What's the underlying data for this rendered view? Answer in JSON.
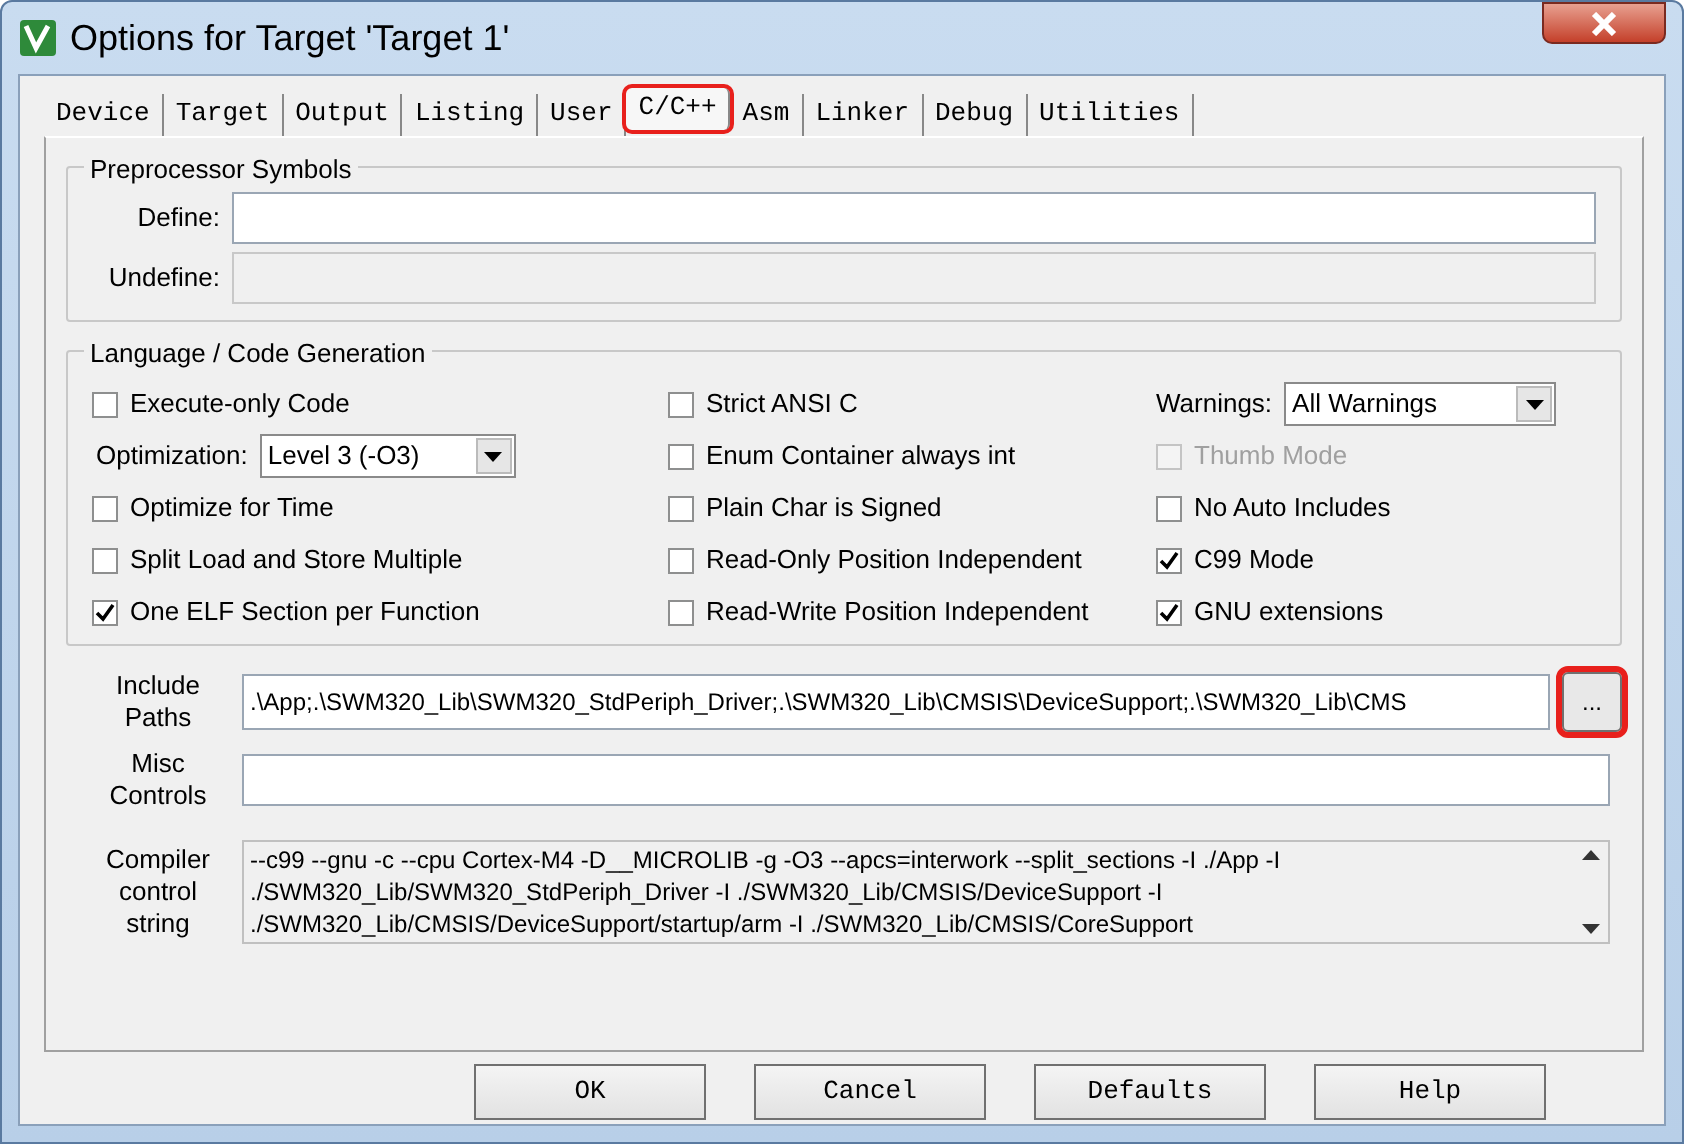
{
  "window": {
    "title": "Options for Target 'Target 1'"
  },
  "tabs": [
    {
      "label": "Device",
      "selected": false,
      "highlighted": false
    },
    {
      "label": "Target",
      "selected": false,
      "highlighted": false
    },
    {
      "label": "Output",
      "selected": false,
      "highlighted": false
    },
    {
      "label": "Listing",
      "selected": false,
      "highlighted": false
    },
    {
      "label": "User",
      "selected": false,
      "highlighted": false
    },
    {
      "label": "C/C++",
      "selected": true,
      "highlighted": true
    },
    {
      "label": "Asm",
      "selected": false,
      "highlighted": false
    },
    {
      "label": "Linker",
      "selected": false,
      "highlighted": false
    },
    {
      "label": "Debug",
      "selected": false,
      "highlighted": false
    },
    {
      "label": "Utilities",
      "selected": false,
      "highlighted": false
    }
  ],
  "preprocessor": {
    "title": "Preprocessor Symbols",
    "fields": [
      {
        "label": "Define:",
        "disabled": false
      },
      {
        "label": "Undefine:",
        "disabled": true
      }
    ]
  },
  "language": {
    "title": "Language / Code Generation",
    "columns": [
      [
        {
          "kind": "checkbox",
          "label": "Execute-only Code",
          "checked": false,
          "disabled": false
        },
        {
          "kind": "select",
          "label": "Optimization:",
          "value": "Level 3 (-O3)"
        },
        {
          "kind": "checkbox",
          "label": "Optimize for Time",
          "checked": false,
          "disabled": false
        },
        {
          "kind": "checkbox",
          "label": "Split Load and Store Multiple",
          "checked": false,
          "disabled": false
        },
        {
          "kind": "checkbox",
          "label": "One ELF Section per Function",
          "checked": true,
          "disabled": false
        }
      ],
      [
        {
          "kind": "checkbox",
          "label": "Strict ANSI C",
          "checked": false,
          "disabled": false
        },
        {
          "kind": "checkbox",
          "label": "Enum Container always int",
          "checked": false,
          "disabled": false
        },
        {
          "kind": "checkbox",
          "label": "Plain Char is Signed",
          "checked": false,
          "disabled": false
        },
        {
          "kind": "checkbox",
          "label": "Read-Only Position Independent",
          "checked": false,
          "disabled": false
        },
        {
          "kind": "checkbox",
          "label": "Read-Write Position Independent",
          "checked": false,
          "disabled": false
        }
      ],
      [
        {
          "kind": "select",
          "label": "Warnings:",
          "value": "All Warnings"
        },
        {
          "kind": "checkbox",
          "label": "Thumb Mode",
          "checked": false,
          "disabled": true
        },
        {
          "kind": "checkbox",
          "label": "No Auto Includes",
          "checked": false,
          "disabled": false
        },
        {
          "kind": "checkbox",
          "label": "C99 Mode",
          "checked": true,
          "disabled": false
        },
        {
          "kind": "checkbox",
          "label": "GNU extensions",
          "checked": true,
          "disabled": false
        }
      ]
    ]
  },
  "include_paths": {
    "label": "Include Paths",
    "value": ".\\App;.\\SWM320_Lib\\SWM320_StdPeriph_Driver;.\\SWM320_Lib\\CMSIS\\DeviceSupport;.\\SWM320_Lib\\CMS",
    "browse": {
      "label": "...",
      "highlighted": true
    }
  },
  "misc_controls": {
    "label": "Misc Controls"
  },
  "compiler_control_string": {
    "label": "Compiler control string",
    "lines": [
      "--c99 --gnu -c --cpu Cortex-M4 -D__MICROLIB -g -O3 --apcs=interwork --split_sections -I ./App -I",
      "./SWM320_Lib/SWM320_StdPeriph_Driver -I ./SWM320_Lib/CMSIS/DeviceSupport -I",
      "./SWM320_Lib/CMSIS/DeviceSupport/startup/arm -I ./SWM320_Lib/CMSIS/CoreSupport"
    ]
  },
  "buttons": [
    "OK",
    "Cancel",
    "Defaults",
    "Help"
  ]
}
